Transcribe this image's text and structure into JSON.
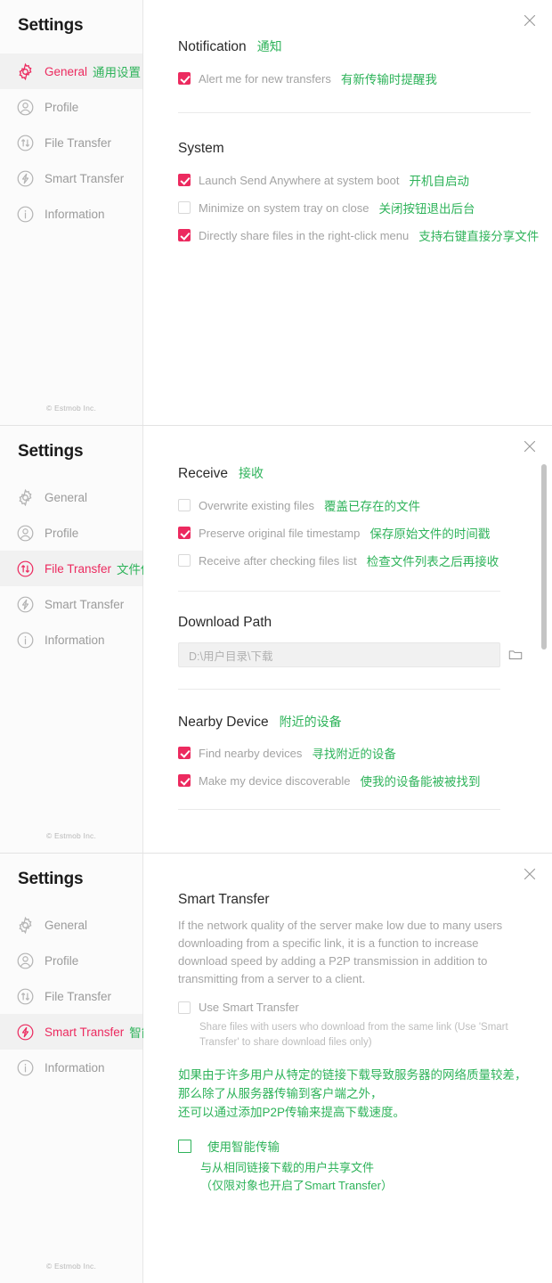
{
  "app": {
    "title": "Settings",
    "footer": "© Estmob Inc.",
    "accent_pink": "#ec2a5f",
    "accent_green": "#2eb35a",
    "close_icon": "close-icon"
  },
  "nav": {
    "items": [
      {
        "id": "general",
        "label": "General",
        "icon": "gear-icon"
      },
      {
        "id": "profile",
        "label": "Profile",
        "icon": "user-icon"
      },
      {
        "id": "file",
        "label": "File Transfer",
        "icon": "updown-arrows-icon"
      },
      {
        "id": "smart",
        "label": "Smart Transfer",
        "icon": "bolt-icon"
      },
      {
        "id": "info",
        "label": "Information",
        "icon": "info-icon"
      }
    ],
    "annotations": {
      "general": "通用设置",
      "file": "文件传输设置",
      "smart": "智能传输"
    }
  },
  "panel_general": {
    "notification": {
      "heading": "Notification",
      "heading_cn": "通知",
      "options": [
        {
          "label": "Alert me for new transfers",
          "cn": "有新传输时提醒我",
          "checked": true
        }
      ]
    },
    "system": {
      "heading": "System",
      "heading_cn": "",
      "options": [
        {
          "label": "Launch Send Anywhere at system boot",
          "cn": "开机自启动",
          "checked": true
        },
        {
          "label": "Minimize on system tray on close",
          "cn": "关闭按钮退出后台",
          "checked": false
        },
        {
          "label": "Directly share files in the right-click menu",
          "cn": "支持右键直接分享文件",
          "checked": true
        }
      ]
    }
  },
  "panel_file": {
    "receive": {
      "heading": "Receive",
      "heading_cn": "接收",
      "options": [
        {
          "label": "Overwrite existing files",
          "cn": "覆盖已存在的文件",
          "checked": false
        },
        {
          "label": "Preserve original file timestamp",
          "cn": "保存原始文件的时间戳",
          "checked": true
        },
        {
          "label": "Receive after checking files list",
          "cn": "检查文件列表之后再接收",
          "checked": false
        }
      ]
    },
    "download_path": {
      "heading": "Download Path",
      "value": "D:\\用户目录\\下载",
      "browse_icon": "folder-icon"
    },
    "nearby": {
      "heading": "Nearby Device",
      "heading_cn": "附近的设备",
      "options": [
        {
          "label": "Find nearby devices",
          "cn": "寻找附近的设备",
          "checked": true
        },
        {
          "label": "Make my device discoverable",
          "cn": "使我的设备能被被找到",
          "checked": true
        }
      ]
    }
  },
  "panel_smart": {
    "heading": "Smart Transfer",
    "description": "If the network quality of the server make low due to many users downloading from a specific link, it is a function to increase download speed by adding a P2P transmission in addition to transmitting from a server to a client.",
    "option": {
      "label": "Use Smart Transfer",
      "checked": false,
      "note": "Share files with users who download from the same link (Use 'Smart Transfer' to share download files only)"
    },
    "cn_description_lines": [
      "如果由于许多用户从特定的链接下载导致服务器的网络质量较差，",
      "那么除了从服务器传输到客户端之外，",
      "还可以通过添加P2P传输来提高下载速度。"
    ],
    "cn_option": {
      "label": "使用智能传输",
      "checked": false,
      "note_line1": "与从相同链接下载的用户共享文件",
      "note_line2": "（仅限对象也开启了Smart Transfer）"
    }
  }
}
